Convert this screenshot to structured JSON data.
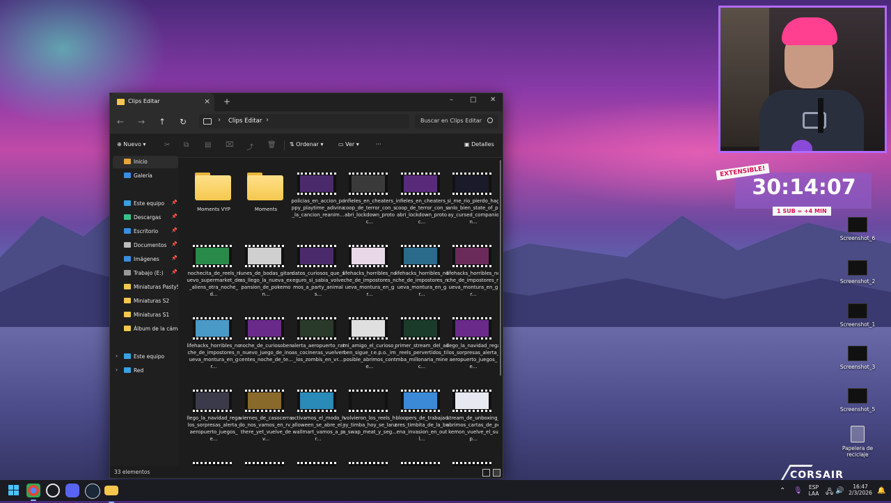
{
  "explorer": {
    "tab_title": "Clips Editar",
    "breadcrumb": "Clips Editar",
    "search_placeholder": "Buscar en Clips Editar",
    "toolbar": {
      "new_label": "Nuevo",
      "sort_label": "Ordenar",
      "view_label": "Ver",
      "more_label": "···",
      "details_label": "Detalles"
    },
    "sidebar": [
      {
        "label": "Inicio",
        "icon": "home-icon",
        "color": "#e8a33d"
      },
      {
        "label": "Galería",
        "icon": "gallery-icon",
        "color": "#3a8de0"
      },
      {
        "label": "Este equipo",
        "icon": "computer-icon",
        "color": "#3aa0e0",
        "pinned": true
      },
      {
        "label": "Descargas",
        "icon": "download-icon",
        "color": "#36c48a",
        "pinned": true
      },
      {
        "label": "Escritorio",
        "icon": "desktop-icon",
        "color": "#3a8de0",
        "pinned": true
      },
      {
        "label": "Documentos",
        "icon": "document-icon",
        "color": "#bdbdbd",
        "pinned": true
      },
      {
        "label": "Imágenes",
        "icon": "image-icon",
        "color": "#3a8de0",
        "pinned": true
      },
      {
        "label": "Trabajo (E:)",
        "icon": "drive-icon",
        "color": "#9a9a9a",
        "pinned": true
      },
      {
        "label": "Miniaturas PastyStre",
        "icon": "folder-icon",
        "color": "#f5c74e"
      },
      {
        "label": "Miniaturas S2",
        "icon": "folder-icon",
        "color": "#f5c74e"
      },
      {
        "label": "Miniaturas S1",
        "icon": "folder-icon",
        "color": "#f5c74e"
      },
      {
        "label": "Álbum de la cámar",
        "icon": "folder-icon",
        "color": "#f5c74e"
      },
      {
        "label": "Este equipo",
        "icon": "computer-icon",
        "color": "#3aa0e0",
        "expandable": true
      },
      {
        "label": "Red",
        "icon": "network-icon",
        "color": "#3aa0e0",
        "expandable": true
      }
    ],
    "items": [
      {
        "name": "Moments VYP",
        "type": "folder"
      },
      {
        "name": "Moments",
        "type": "folder"
      },
      {
        "name": "policias_en_accion_poppy_playtime_adivina_la_cancion_reanim...",
        "type": "video",
        "thumb": "#4a2a6a"
      },
      {
        "name": "infieles_en_cheaters_coop_de_terror_con_sabri_lockdown_protoc...",
        "type": "video",
        "thumb": "#3a3a3a"
      },
      {
        "name": "infieles_en_cheaters_coop_de_terror_con_sabri_lockdown_protoc...",
        "type": "video",
        "thumb": "#5a2a7a"
      },
      {
        "name": "si_me_rio_pierdo_haganlo_bien_state_of_play_cursed_companion...",
        "type": "video",
        "thumb": "#1a1a2a"
      },
      {
        "name": "nochecita_de_reels_nuevo_supermarket_de_aliens_otra_noche_d...",
        "type": "video",
        "thumb": "#2a8a4a"
      },
      {
        "name": "lunes_de_bodas_gitanas_llego_la_nueva_expansion_de_pokemon...",
        "type": "video",
        "thumb": "#d0d0d0"
      },
      {
        "name": "datos_curiosos_que_seguro_si_sabia_volvemos_a_party_animals...",
        "type": "video",
        "thumb": "#4a2a6a"
      },
      {
        "name": "lifehacks_horribles_noche_de_impostores_nueva_montura_en_gr...",
        "type": "video",
        "thumb": "#e8d8e8"
      },
      {
        "name": "lifehacks_horribles_noche_de_impostores_nueva_montura_en_gr...",
        "type": "video",
        "thumb": "#2a6a8a"
      },
      {
        "name": "lifehacks_horribles_noche_de_impostores_nueva_montura_en_gr...",
        "type": "video",
        "thumb": "#6a2a5a"
      },
      {
        "name": "lifehacks_horribles_noche_de_impostores_nueva_montura_en_gr...",
        "type": "video",
        "thumb": "#4a9ac8"
      },
      {
        "name": "noche_de_curiosoben_nuevo_juego_de_inocentes_noche_de_te...",
        "type": "video",
        "thumb": "#6a2a8a"
      },
      {
        "name": "alerta_aeropuerto_ratas_cocineras_vuelven_los_zombis_en_vr...",
        "type": "video",
        "thumb": "#2a3a2a"
      },
      {
        "name": "mi_amigo_el_curioso_ben_sigue_r.e.p.o._imposible_abrimos_conte...",
        "type": "video",
        "thumb": "#e0e0e0"
      },
      {
        "name": "primer_stream_del_ao_reels_pervertidos_timba_millonaria_minec...",
        "type": "video",
        "thumb": "#1a3a2a"
      },
      {
        "name": "llego_la_navidad_regalos_sorpresas_alerta_aeropuerto_juegos_e...",
        "type": "video",
        "thumb": "#6a2a8a"
      },
      {
        "name": "llego_la_navidad_regalos_sorpresas_alerta_aeropuerto_juegos_e...",
        "type": "video",
        "thumb": "#3a3a4a"
      },
      {
        "name": "viernes_de_casocerrado_nos_vamos_en_rv_there_yet_vuelve_dev...",
        "type": "video",
        "thumb": "#8a6a2a"
      },
      {
        "name": "activamos_el_modo_halloween_se_abre_el_wallmart_vamos_a_pr...",
        "type": "video",
        "thumb": "#2a8ab8"
      },
      {
        "name": "volvieron_los_reels_hay_timba_hoy_se_lanza_swap_meat_y_seg...",
        "type": "video",
        "thumb": "#1a1a1a"
      },
      {
        "name": "bloopers_de_trabajadores_timbita_de_la_buena_invasion_en_outl...",
        "type": "video",
        "thumb": "#3a8ad8"
      },
      {
        "name": "stream_de_unboxing_abrimos_cartas_de_pokemon_vuelve_el_sup...",
        "type": "video",
        "thumb": "#e8e8f0"
      }
    ],
    "status": "33 elementos"
  },
  "overlay": {
    "extensible_tag": "EXTENSIBLE!",
    "timer": "30:14:07",
    "sub_note": "1 SUB = +4 MIN",
    "brand": "CORSAIR"
  },
  "desktop_icons": [
    {
      "label": "Screenshot_6"
    },
    {
      "label": "Screenshot_2"
    },
    {
      "label": "Screenshot_1"
    },
    {
      "label": "Screenshot_3"
    },
    {
      "label": "Screenshot_5"
    },
    {
      "label": "Papelera de reciclaje"
    }
  ],
  "taskbar": {
    "lang_line1": "ESP",
    "lang_line2": "LAA",
    "time": "16:47",
    "date": "2/3/2026"
  },
  "colors": {
    "accent": "#b26bff",
    "folder": "#f5c74e",
    "timer_tag": "#d4145a"
  }
}
